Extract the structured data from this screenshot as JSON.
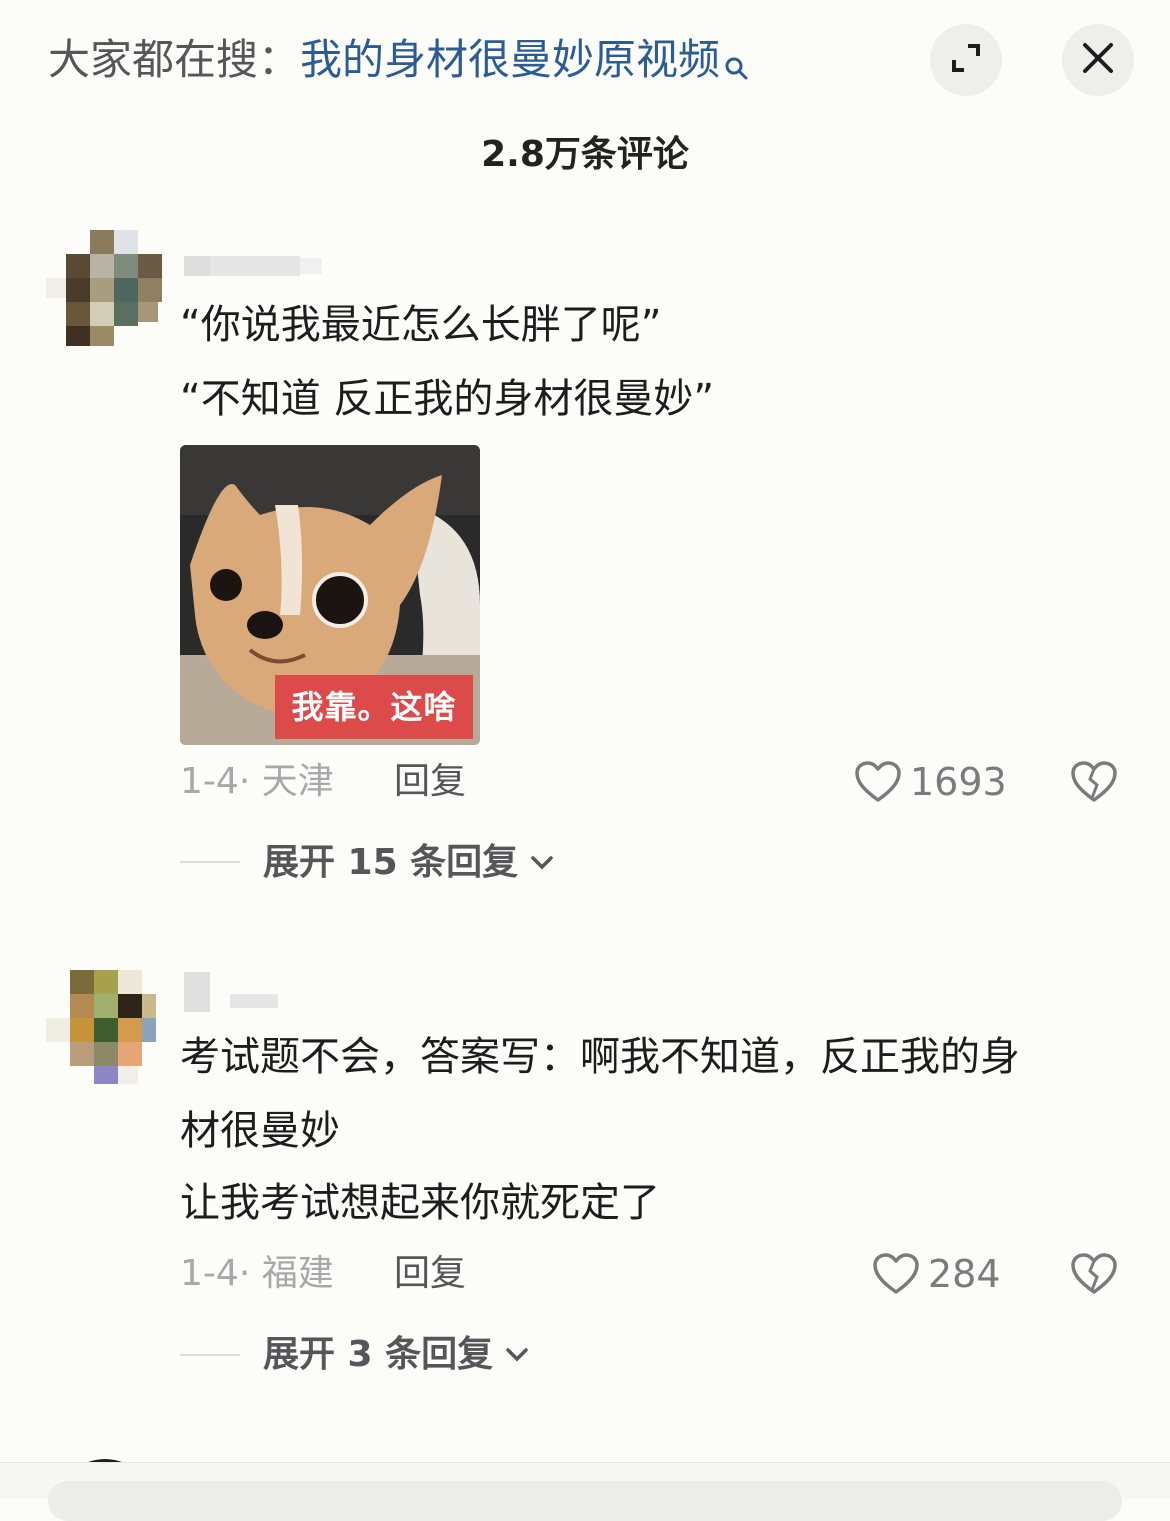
{
  "header": {
    "search_prefix": "大家都在搜：",
    "search_query": "我的身材很曼妙原视频",
    "search_icon": "search-icon",
    "expand_icon": "expand-icon",
    "close_icon": "close-icon"
  },
  "comment_count": "2.8万条评论",
  "comments": [
    {
      "lines": [
        "“你说我最近怎么长胖了呢”",
        "“不知道 反正我的身材很曼妙”"
      ],
      "sticker_caption": "我靠。这啥",
      "date": "1-4",
      "separator": "·",
      "location": "天津",
      "reply_label": "回复",
      "likes": "1693",
      "expand_label": "展开 15 条回复"
    },
    {
      "lines": [
        "考试题不会，答案写：啊我不知道，反正我的身",
        "材很曼妙",
        "让我考试想起来你就死定了"
      ],
      "date": "1-4",
      "separator": "·",
      "location": "福建",
      "reply_label": "回复",
      "likes": "284",
      "expand_label": "展开 3 条回复"
    }
  ],
  "colors": {
    "background": "#fcfcf9",
    "search_query": "#2c5c96",
    "sticker_caption_bg": "#dd4a4a"
  }
}
